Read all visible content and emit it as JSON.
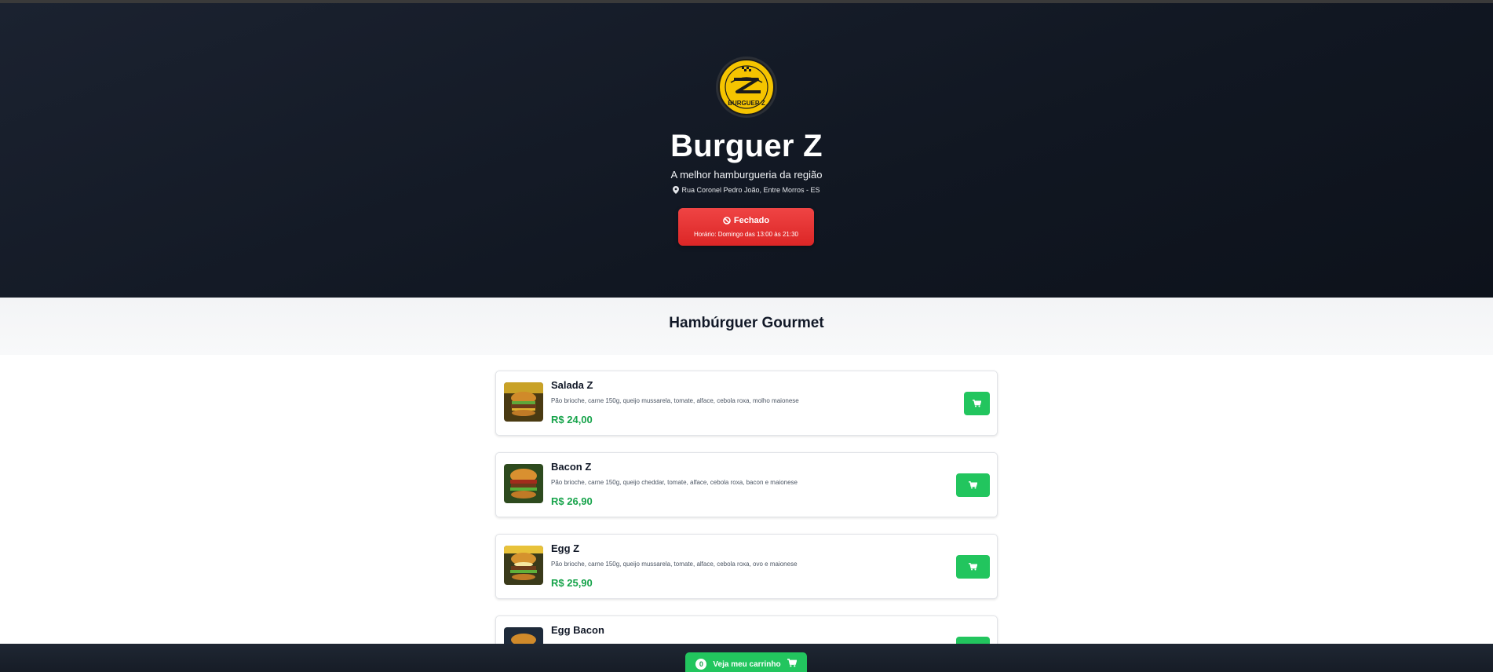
{
  "header": {
    "logo_text": "BURGUER Z",
    "restaurant_name": "Burguer Z",
    "tagline": "A melhor hamburgueria da região",
    "address": "Rua Coronel Pedro João, Entre Morros - ES",
    "status": {
      "label": "Fechado",
      "hours": "Horário: Domingo das 13:00 às 21:30",
      "color": "#dc2626"
    }
  },
  "category": {
    "title": "Hambúrguer Gourmet"
  },
  "products": [
    {
      "name": "Salada Z",
      "description": "Pão brioche, carne 150g, queijo mussarela, tomate, alface, cebola roxa, molho maionese",
      "price": "R$ 24,00"
    },
    {
      "name": "Bacon Z",
      "description": "Pão brioche, carne 150g, queijo cheddar, tomate, alface, cebola roxa, bacon e maionese",
      "price": "R$ 26,90"
    },
    {
      "name": "Egg Z",
      "description": "Pão brioche, carne 150g, queijo mussarela, tomate, alface, cebola roxa, ovo e maionese",
      "price": "R$ 25,90"
    },
    {
      "name": "Egg Bacon",
      "description": "",
      "price": ""
    }
  ],
  "cart": {
    "count": "0",
    "label": "Veja meu carrinho"
  },
  "icons": {
    "location": "map-pin-icon",
    "closed": "ban-icon",
    "cart": "cart-icon"
  },
  "colors": {
    "accent_green": "#22c55e",
    "price_green": "#16a34a",
    "closed_red": "#dc2626",
    "brand_yellow": "#f5c400"
  }
}
